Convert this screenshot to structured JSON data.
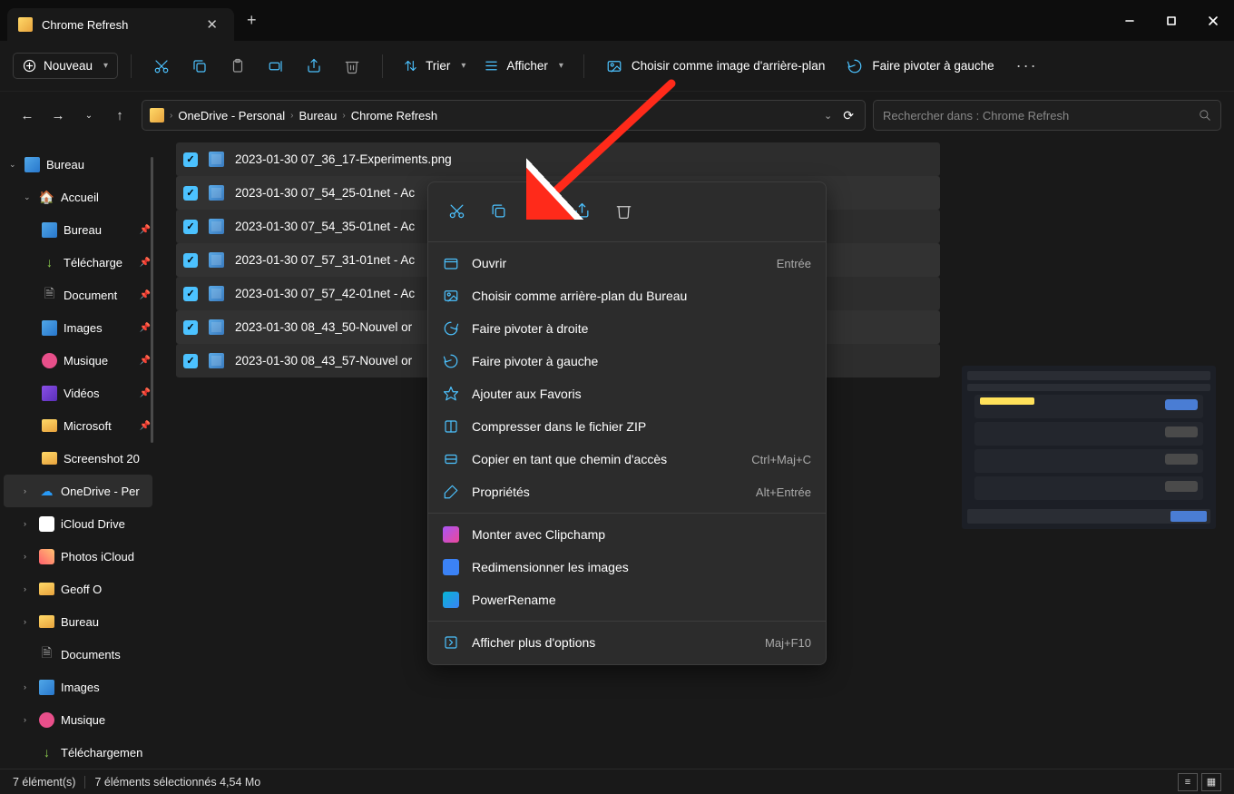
{
  "window": {
    "tab_title": "Chrome Refresh"
  },
  "toolbar": {
    "new": "Nouveau",
    "sort": "Trier",
    "view": "Afficher",
    "set_bg": "Choisir comme image d'arrière-plan",
    "rotate_left": "Faire pivoter à gauche"
  },
  "breadcrumb": {
    "parts": [
      "OneDrive - Personal",
      "Bureau",
      "Chrome Refresh"
    ]
  },
  "search": {
    "placeholder": "Rechercher dans : Chrome Refresh"
  },
  "sidebar": {
    "bureau_root": "Bureau",
    "accueil": "Accueil",
    "bureau": "Bureau",
    "telecharge": "Télécharge",
    "documents": "Document",
    "images": "Images",
    "musique": "Musique",
    "videos": "Vidéos",
    "microsoft": "Microsoft",
    "screenshot": "Screenshot 20",
    "onedrive": "OneDrive - Per",
    "icloud_drive": "iCloud Drive",
    "photos_icloud": "Photos iCloud",
    "geoff": "Geoff O",
    "bureau2": "Bureau",
    "documents2": "Documents",
    "images2": "Images",
    "musique2": "Musique",
    "telechargemen": "Téléchargemen"
  },
  "files": [
    "2023-01-30 07_36_17-Experiments.png",
    "2023-01-30 07_54_25-01net - Ac",
    "2023-01-30 07_54_35-01net - Ac",
    "2023-01-30 07_57_31-01net - Ac",
    "2023-01-30 07_57_42-01net - Ac",
    "2023-01-30 08_43_50-Nouvel or",
    "2023-01-30 08_43_57-Nouvel or"
  ],
  "context_menu": {
    "open": "Ouvrir",
    "open_shortcut": "Entrée",
    "set_desktop_bg": "Choisir comme arrière-plan du Bureau",
    "rotate_right": "Faire pivoter à droite",
    "rotate_left": "Faire pivoter à gauche",
    "add_favorites": "Ajouter aux Favoris",
    "compress_zip": "Compresser dans le fichier ZIP",
    "copy_path": "Copier en tant que chemin d'accès",
    "copy_path_shortcut": "Ctrl+Maj+C",
    "properties": "Propriétés",
    "properties_shortcut": "Alt+Entrée",
    "clipchamp": "Monter avec Clipchamp",
    "resize_images": "Redimensionner les images",
    "powerrename": "PowerRename",
    "show_more": "Afficher plus d'options",
    "show_more_shortcut": "Maj+F10"
  },
  "status": {
    "count": "7 élément(s)",
    "selected": "7 éléments sélectionnés  4,54 Mo"
  }
}
